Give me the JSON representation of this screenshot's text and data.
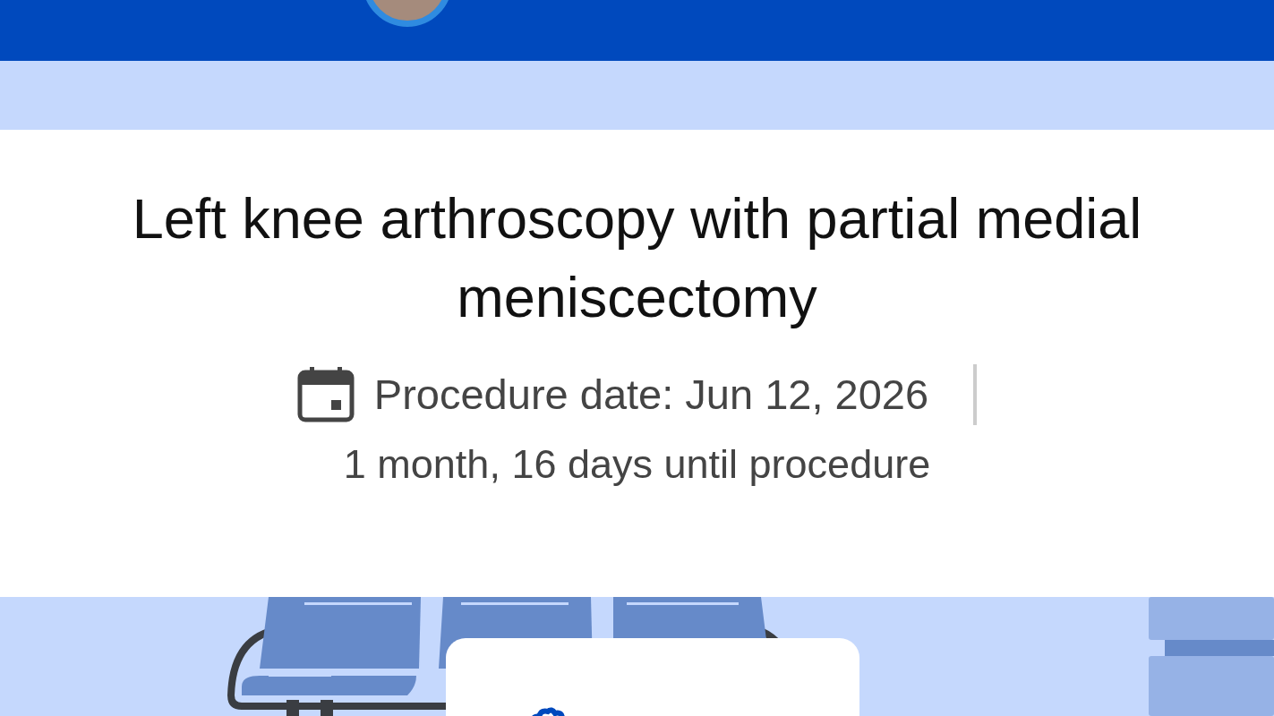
{
  "procedure": {
    "title": "Left knee arthroscopy with partial medial meniscectomy",
    "date": "Procedure date: Jun 12, 2026",
    "countdown": "1 month, 16 days until procedure"
  }
}
